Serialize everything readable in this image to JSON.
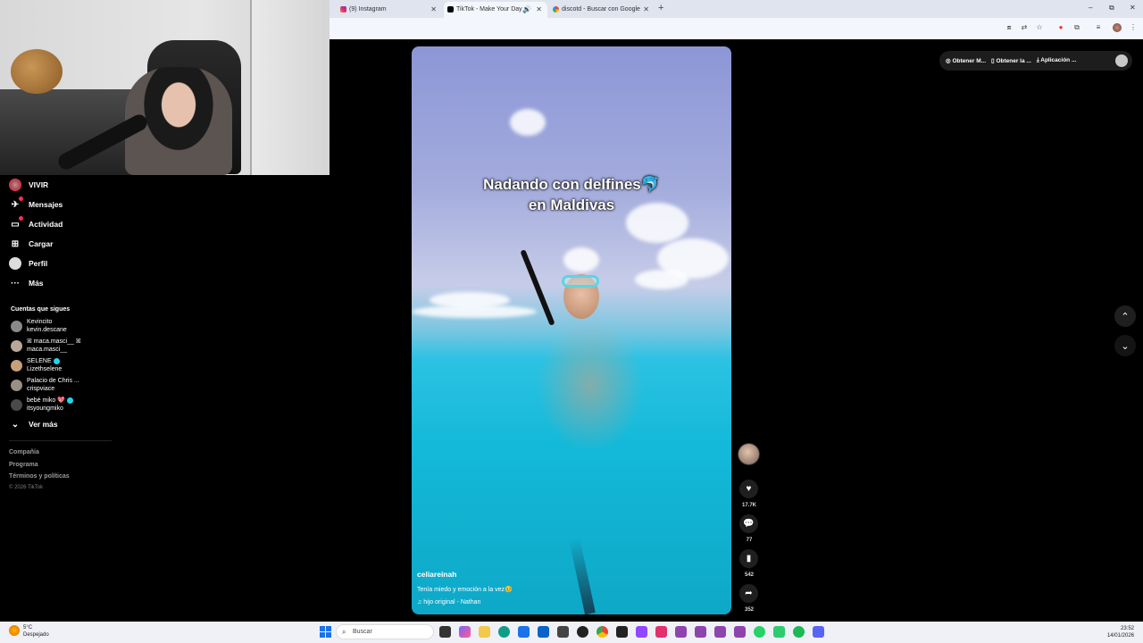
{
  "browser": {
    "tabs": [
      {
        "label": "(9) Instagram",
        "active": false
      },
      {
        "label": "TikTok - Make Your Day",
        "active": true
      },
      {
        "label": "discotd - Buscar con Google",
        "active": false
      }
    ],
    "window_controls": {
      "minimize": "–",
      "restore": "⧉",
      "close": "✕"
    }
  },
  "tiktok": {
    "nav": [
      {
        "label": "VIVIR",
        "icon": "live-avatar-icon"
      },
      {
        "label": "Mensajes",
        "icon": "messages-icon"
      },
      {
        "label": "Actividad",
        "icon": "activity-icon"
      },
      {
        "label": "Cargar",
        "icon": "upload-icon"
      },
      {
        "label": "Perfil",
        "icon": "profile-icon"
      },
      {
        "label": "Más",
        "icon": "more-icon"
      }
    ],
    "following_title": "Cuentas que sigues",
    "following": [
      {
        "name": "Kevincito",
        "handle": "kevin.descane",
        "verified": false
      },
      {
        "name": "ꕤ maca.masci__ ꕤ",
        "handle": "maca.masci__",
        "verified": false
      },
      {
        "name": "SELENE",
        "handle": "Lizethselene",
        "verified": true
      },
      {
        "name": "Palacio de Chris ...",
        "handle": "crispviace",
        "verified": false
      },
      {
        "name": "bebé miko 💖",
        "handle": "itsyoungmiko",
        "verified": true
      }
    ],
    "see_more": "Ver más",
    "footer": [
      "Compañía",
      "Programa",
      "Términos y políticas"
    ],
    "copyright": "© 2026 TikTok",
    "video": {
      "overlay_line1": "Nadando con delfines🐬",
      "overlay_line2": "en Maldivas",
      "author": "celiareinah",
      "description": "Tenía miedo y emoción a la vez🥹",
      "music": "♫ hijo original - Nathan"
    },
    "actions": {
      "likes": "17.7K",
      "comments": "77",
      "saves": "542",
      "shares": "352"
    },
    "top_pills": [
      "Obtener M...",
      "Obtener la ...",
      "Aplicación ..."
    ]
  },
  "taskbar": {
    "weather_temp": "5°C",
    "weather_desc": "Despejado",
    "search_placeholder": "Buscar",
    "time": "23:52",
    "date": "14/01/2026"
  },
  "colors": {
    "tiktok_red": "#fe2c55",
    "tiktok_cyan": "#20d5ec",
    "chrome_bg": "#f3f6fc"
  }
}
